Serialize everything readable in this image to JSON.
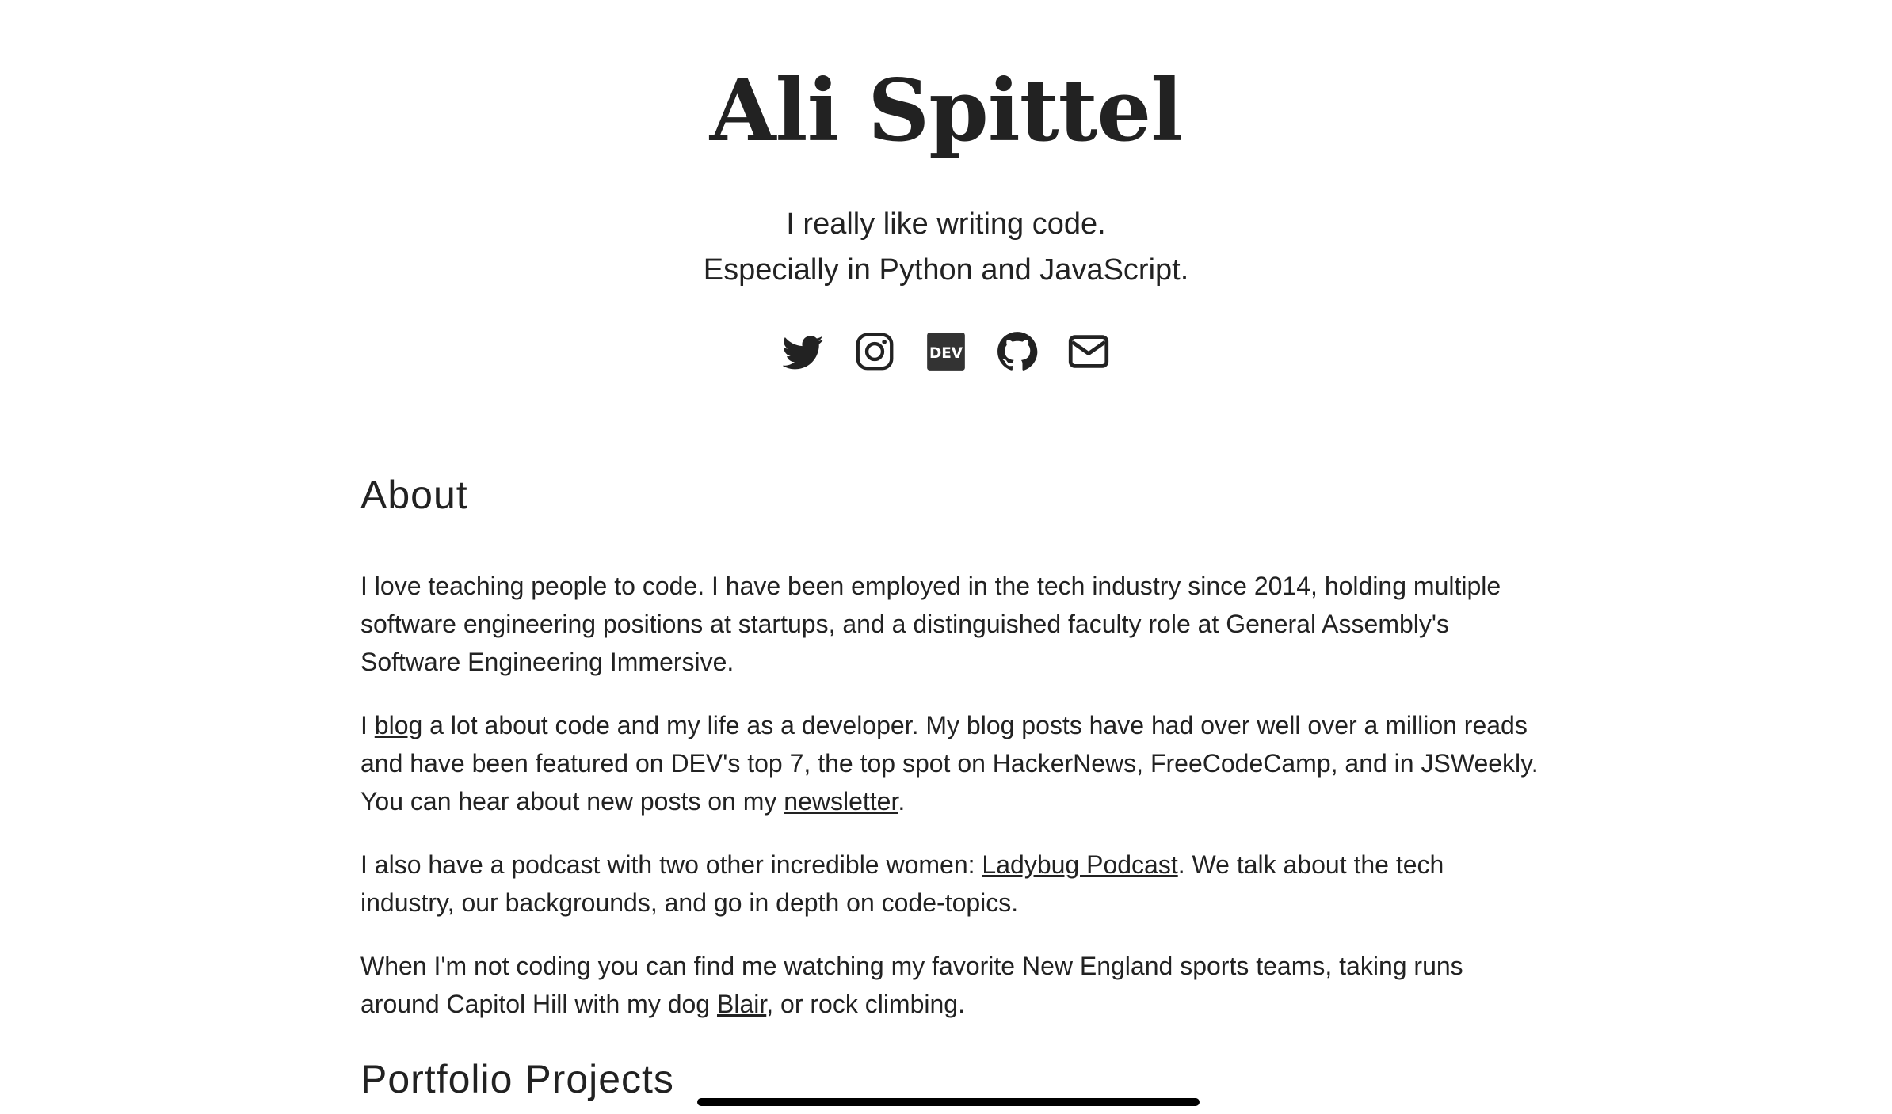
{
  "header": {
    "title": "Ali Spittel",
    "tagline_line1": "I really like writing code.",
    "tagline_line2": "Especially in Python and JavaScript."
  },
  "social": [
    {
      "name": "twitter-icon"
    },
    {
      "name": "instagram-icon"
    },
    {
      "name": "dev-icon",
      "label": "DEV"
    },
    {
      "name": "github-icon"
    },
    {
      "name": "email-icon"
    }
  ],
  "about": {
    "heading": "About",
    "p1": "I love teaching people to code. I have been employed in the tech industry since 2014, holding multiple software engineering positions at startups, and a distinguished faculty role at General Assembly's Software Engineering Immersive.",
    "p2_before": "I ",
    "p2_link1": "blog",
    "p2_middle": " a lot about code and my life as a developer. My blog posts have had over well over a million reads and have been featured on DEV's top 7, the top spot on HackerNews, FreeCodeCamp, and in JSWeekly. You can hear about new posts on my ",
    "p2_link2": "newsletter",
    "p2_after": ".",
    "p3_before": "I also have a podcast with two other incredible women: ",
    "p3_link": "Ladybug Podcast",
    "p3_after": ". We talk about the tech industry, our backgrounds, and go in depth on code-topics.",
    "p4_before": "When I'm not coding you can find me watching my favorite New England sports teams, taking runs around Capitol Hill with my dog ",
    "p4_link": "Blair",
    "p4_after": ", or rock climbing."
  },
  "portfolio": {
    "heading": "Portfolio Projects"
  },
  "colors": {
    "text": "#222222",
    "background": "#ffffff",
    "underline_bar": "#000000"
  }
}
